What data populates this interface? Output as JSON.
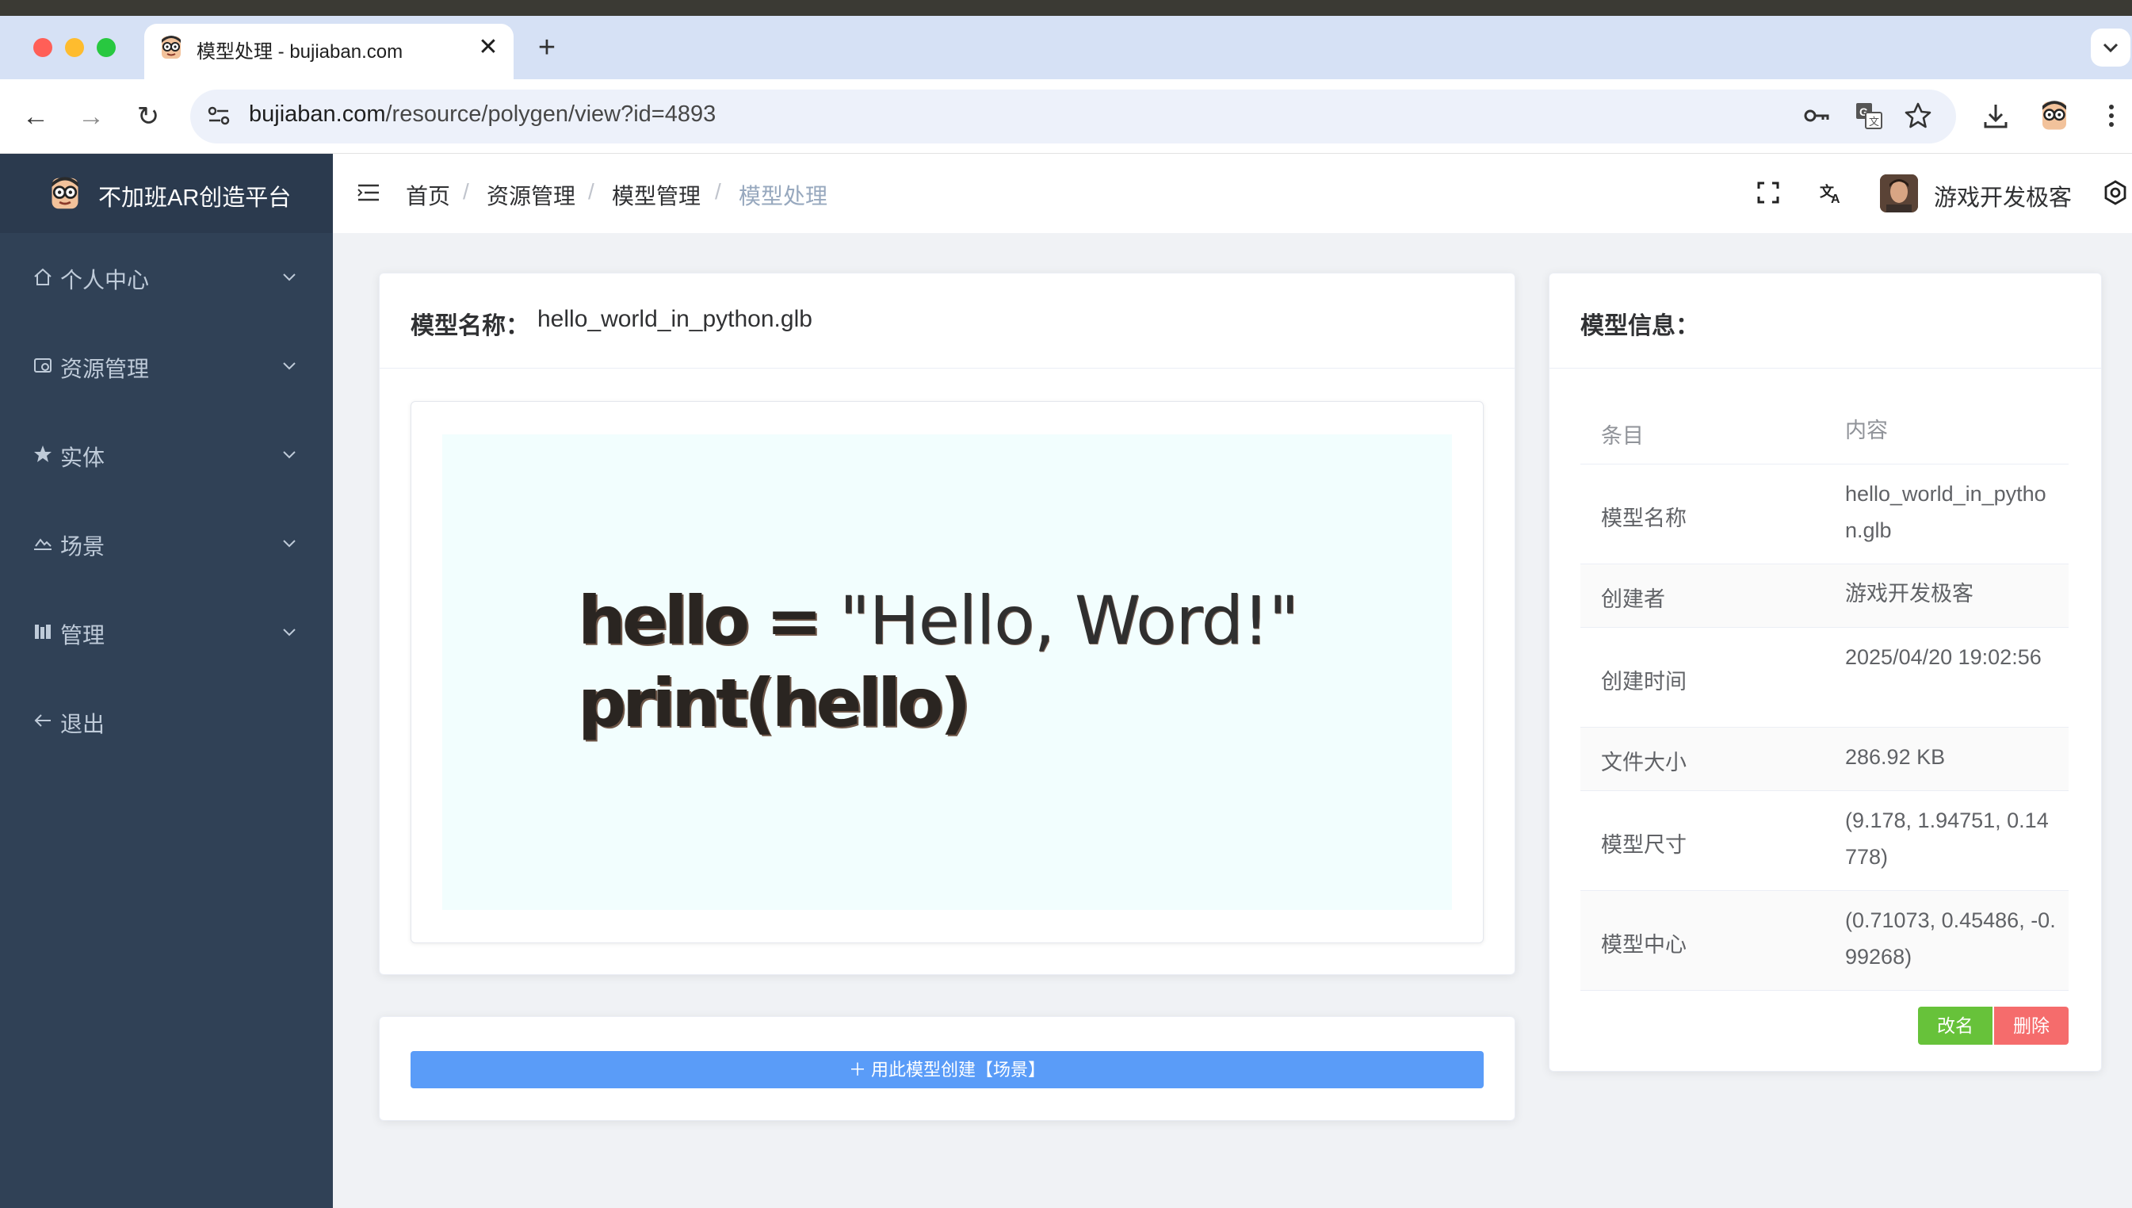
{
  "browser": {
    "tab_title": "模型处理 - bujiaban.com",
    "tab_close": "✕",
    "new_tab": "+",
    "url_host": "bujiaban.com",
    "url_path": "/resource/polygen/view?id=4893",
    "back": "←",
    "forward": "→",
    "reload": "↻"
  },
  "sidebar": {
    "title": "不加班AR创造平台",
    "items": [
      {
        "label": "个人中心",
        "icon": "home-icon"
      },
      {
        "label": "资源管理",
        "icon": "resource-icon"
      },
      {
        "label": "实体",
        "icon": "star-icon"
      },
      {
        "label": "场景",
        "icon": "landscape-icon"
      },
      {
        "label": "管理",
        "icon": "manage-icon"
      },
      {
        "label": "退出",
        "icon": "back-arrow-icon"
      }
    ]
  },
  "navbar": {
    "breadcrumb": [
      "首页",
      "资源管理",
      "模型管理",
      "模型处理"
    ],
    "separator": "/",
    "user_name": "游戏开发极客"
  },
  "model_card": {
    "title_label": "模型名称：",
    "title_value": "hello_world_in_python.glb",
    "preview_lines": [
      "hello = ",
      "\"Hello, Word!\"",
      "print(hello)"
    ]
  },
  "action_card": {
    "create_button": "＋ 用此模型创建【场景】"
  },
  "info_card": {
    "title": "模型信息：",
    "header": {
      "key": "条目",
      "value": "内容"
    },
    "rows": [
      {
        "key": "模型名称",
        "value": "hello_world_in_python.glb"
      },
      {
        "key": "创建者",
        "value": "游戏开发极客"
      },
      {
        "key": "创建时间",
        "value": "2025/04/20 19:02:56"
      },
      {
        "key": "文件大小",
        "value": "286.92 KB"
      },
      {
        "key": "模型尺寸",
        "value": "(9.178, 1.94751, 0.14778)"
      },
      {
        "key": "模型中心",
        "value": "(0.71073, 0.45486, -0.99268)"
      }
    ],
    "rename_button": "改名",
    "delete_button": "删除"
  },
  "colors": {
    "sidebar_bg": "#304156",
    "primary": "#5a9cf8",
    "success": "#67c23a",
    "danger": "#f56c6c"
  }
}
